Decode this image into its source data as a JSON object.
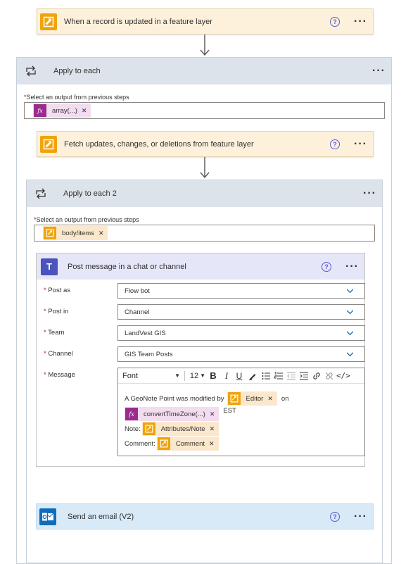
{
  "trigger": {
    "title": "When a record is updated in a feature layer"
  },
  "apply1": {
    "title": "Apply to each",
    "select_label": "Select an output from previous steps",
    "token": "array(...)"
  },
  "fetch": {
    "title": "Fetch updates, changes, or deletions from feature layer"
  },
  "apply2": {
    "title": "Apply to each 2",
    "select_label": "Select an output from previous steps",
    "token": "body/items"
  },
  "teams": {
    "title": "Post message in a chat or channel",
    "fields": {
      "post_as": {
        "label": "Post as",
        "value": "Flow bot"
      },
      "post_in": {
        "label": "Post in",
        "value": "Channel"
      },
      "team": {
        "label": "Team",
        "value": "LandVest GIS"
      },
      "channel": {
        "label": "Channel",
        "value": "GIS Team Posts"
      },
      "message": {
        "label": "Message"
      }
    },
    "toolbar": {
      "font": "Font",
      "size": "12"
    },
    "message": {
      "line1_text": "A GeoNote Point was modified by",
      "editor_token": "Editor",
      "on_text": "on",
      "convert_token": "convertTimeZone(...)",
      "est_text": "EST",
      "note_text": "Note:",
      "attr_token": "Attributes/Note",
      "comment_text": "Comment:",
      "comment_token": "Comment"
    }
  },
  "email": {
    "title": "Send an email (V2)"
  },
  "colors": {
    "accent": "#f0a30a",
    "teams": "#4b53bc",
    "outlook": "#0f6cbd",
    "fx": "#9b2c8e"
  }
}
